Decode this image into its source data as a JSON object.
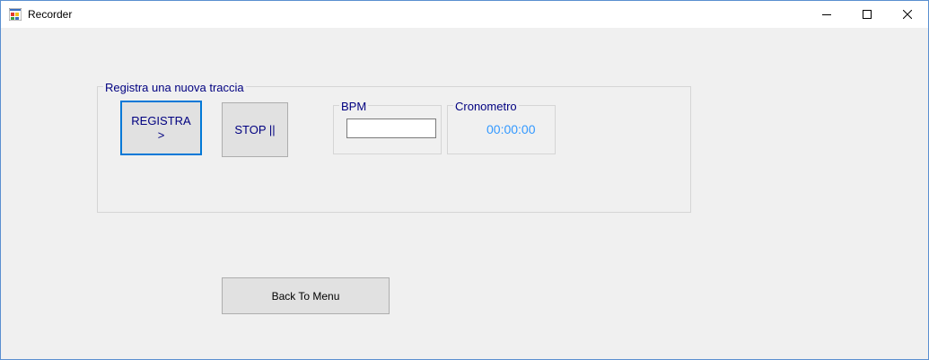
{
  "window": {
    "title": "Recorder",
    "icon": "windows-form-icon",
    "controls": [
      "minimize-icon",
      "maximize-icon",
      "close-icon"
    ]
  },
  "main_group": {
    "label": "Registra una nuova traccia",
    "registra_button": "REGISTRA\n>",
    "stop_button": "STOP ||"
  },
  "bpm": {
    "label": "BPM",
    "value": ""
  },
  "cronometro": {
    "label": "Cronometro",
    "value": "00:00:00",
    "value_color": "#3399ff"
  },
  "back_button": "Back To Menu",
  "colors": {
    "label_text": "#000080",
    "focus_border": "#0078d7",
    "window_border": "#5a8fd0"
  }
}
